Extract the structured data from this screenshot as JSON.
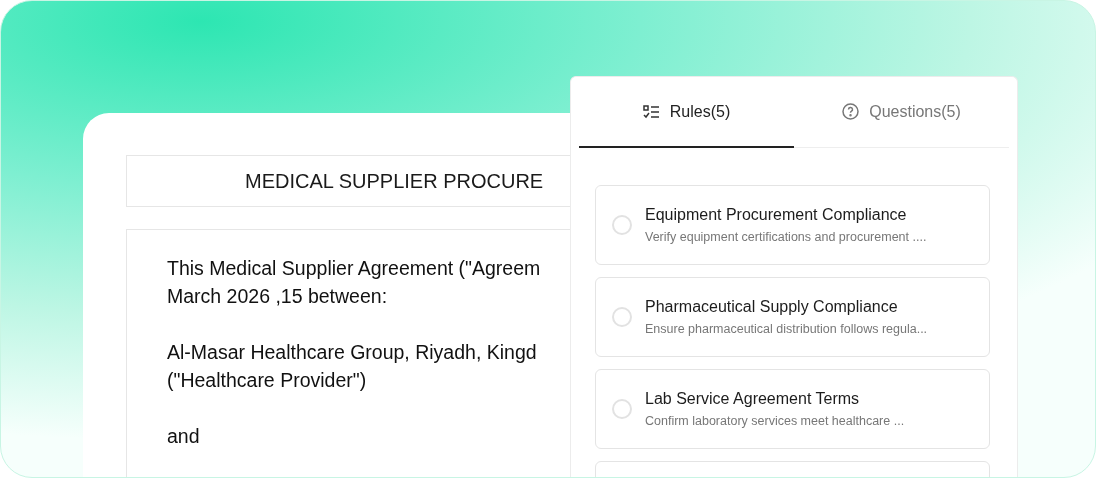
{
  "document": {
    "title": "MEDICAL SUPPLIER PROCURE",
    "paragraphs": [
      {
        "lines": [
          "This Medical Supplier Agreement (\"Agreem",
          "March 2026 ,15 between:"
        ]
      },
      {
        "lines": [
          "Al-Masar Healthcare Group, Riyadh, Kingd",
          "(\"Healthcare Provider\")"
        ]
      },
      {
        "lines": [
          "and"
        ]
      }
    ]
  },
  "panel": {
    "tabs": [
      {
        "kind": "rules",
        "label": "Rules(5)",
        "selected": true
      },
      {
        "kind": "questions",
        "label": "Questions(5)",
        "selected": false
      }
    ],
    "rules": [
      {
        "kind": "rule",
        "title": "Equipment Procurement Compliance",
        "description": "Verify equipment certifications and procurement ....",
        "checked": false
      },
      {
        "kind": "rule",
        "title": "Pharmaceutical Supply Compliance",
        "description": "Ensure pharmaceutical distribution follows regula...",
        "checked": false
      },
      {
        "kind": "rule",
        "title": "Lab Service Agreement Terms",
        "description": "Confirm laboratory services meet healthcare ...",
        "checked": false
      },
      {
        "kind": "partial"
      }
    ]
  }
}
